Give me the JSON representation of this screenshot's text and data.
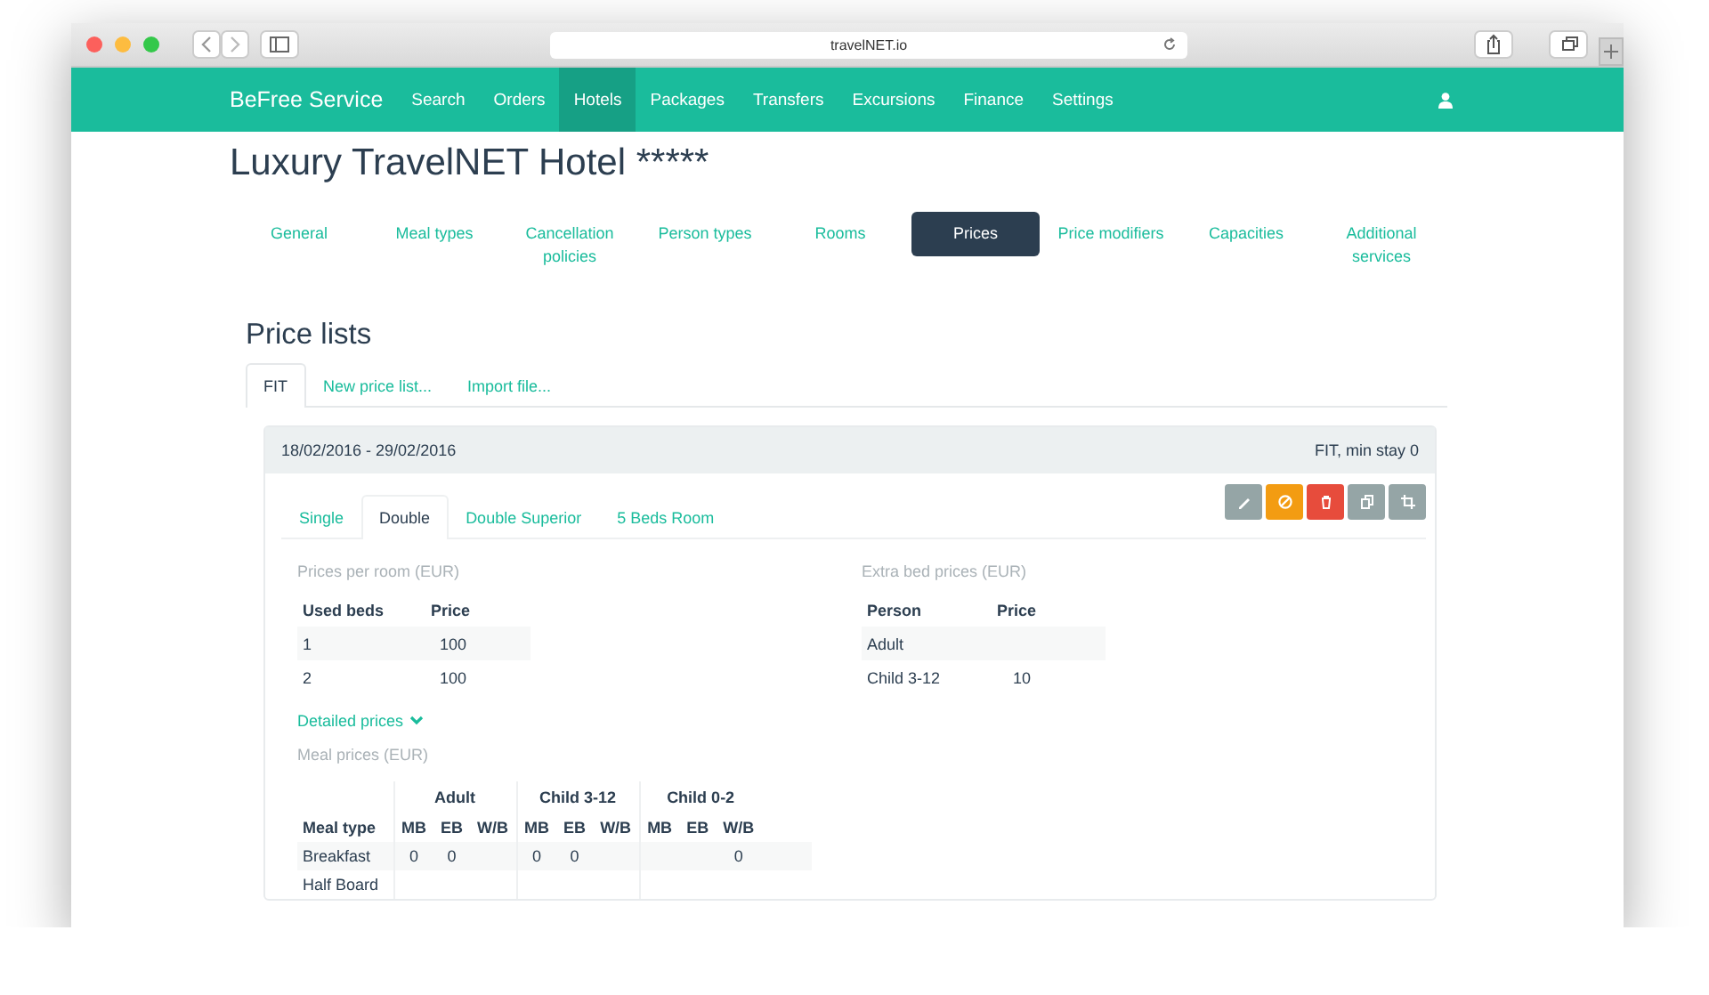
{
  "browser": {
    "url": "travelNET.io"
  },
  "navbar": {
    "brand": "BeFree Service",
    "items": [
      {
        "label": "Search",
        "selected": false
      },
      {
        "label": "Orders",
        "selected": false
      },
      {
        "label": "Hotels",
        "selected": true
      },
      {
        "label": "Packages",
        "selected": false
      },
      {
        "label": "Transfers",
        "selected": false
      },
      {
        "label": "Excursions",
        "selected": false
      },
      {
        "label": "Finance",
        "selected": false
      },
      {
        "label": "Settings",
        "selected": false
      }
    ]
  },
  "hotel_title": "Luxury TravelNET Hotel *****",
  "hotel_tabs": [
    {
      "label": "General",
      "selected": false
    },
    {
      "label": "Meal types",
      "selected": false
    },
    {
      "label": "Cancellation policies",
      "selected": false
    },
    {
      "label": "Person types",
      "selected": false
    },
    {
      "label": "Rooms",
      "selected": false
    },
    {
      "label": "Prices",
      "selected": true
    },
    {
      "label": "Price modifiers",
      "selected": false
    },
    {
      "label": "Capacities",
      "selected": false
    },
    {
      "label": "Additional services",
      "selected": false
    }
  ],
  "section_title": "Price lists",
  "price_list_tabs": [
    {
      "label": "FIT",
      "selected": true
    },
    {
      "label": "New price list...",
      "selected": false
    },
    {
      "label": "Import file...",
      "selected": false
    }
  ],
  "price_list": {
    "period": "18/02/2016 - 29/02/2016",
    "summary": "FIT, min stay 0",
    "room_tabs": [
      {
        "label": "Single",
        "selected": false
      },
      {
        "label": "Double",
        "selected": true
      },
      {
        "label": "Double Superior",
        "selected": false
      },
      {
        "label": "5 Beds Room",
        "selected": false
      }
    ],
    "actions": [
      {
        "kind": "edit"
      },
      {
        "kind": "disable"
      },
      {
        "kind": "delete"
      },
      {
        "kind": "copy"
      },
      {
        "kind": "crop"
      }
    ],
    "room_prices": {
      "caption": "Prices per room (EUR)",
      "columns": [
        "Used beds",
        "Price"
      ],
      "rows": [
        [
          "1",
          "100"
        ],
        [
          "2",
          "100"
        ]
      ]
    },
    "extra_bed_prices": {
      "caption": "Extra bed prices (EUR)",
      "columns": [
        "Person",
        "Price"
      ],
      "rows": [
        {
          "person": "Adult"
        },
        {
          "person": "Child 3-12",
          "price": "10"
        }
      ]
    },
    "detailed_prices": {
      "label": "Detailed prices",
      "expanded": true
    },
    "meal_prices": {
      "caption": "Meal prices (EUR)",
      "groups": [
        {
          "label": "Adult",
          "subcolumns": [
            "MB",
            "EB",
            "W/B"
          ]
        },
        {
          "label": "Child 3-12",
          "subcolumns": [
            "MB",
            "EB",
            "W/B"
          ]
        },
        {
          "label": "Child 0-2",
          "subcolumns": [
            "MB",
            "EB",
            "W/B"
          ]
        }
      ],
      "first_column": "Meal type",
      "rows": [
        {
          "name": "Breakfast",
          "cells": [
            "0",
            "0",
            null,
            "0",
            "0",
            null,
            null,
            null,
            "0"
          ]
        },
        {
          "name": "Half Board",
          "cells": [
            null,
            null,
            null,
            null,
            null,
            null,
            null,
            null,
            null
          ]
        }
      ]
    }
  }
}
